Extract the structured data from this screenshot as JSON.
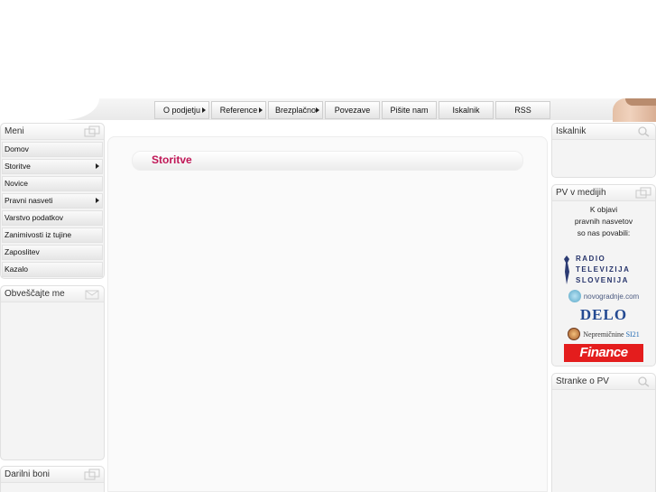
{
  "nav": {
    "items": [
      {
        "label": "O podjetju",
        "has_arrow": true
      },
      {
        "label": "Reference",
        "has_arrow": true
      },
      {
        "label": "Brezplačno",
        "has_arrow": true
      },
      {
        "label": "Povezave",
        "has_arrow": false
      },
      {
        "label": "Pišite nam",
        "has_arrow": false
      },
      {
        "label": "Iskalnik",
        "has_arrow": false
      },
      {
        "label": "RSS",
        "has_arrow": false
      }
    ]
  },
  "left": {
    "menu_title": "Meni",
    "menu_items": [
      {
        "label": "Domov",
        "has_arrow": false
      },
      {
        "label": "Storitve",
        "has_arrow": true
      },
      {
        "label": "Novice",
        "has_arrow": false
      },
      {
        "label": "Pravni nasveti",
        "has_arrow": true
      },
      {
        "label": "Varstvo podatkov",
        "has_arrow": false
      },
      {
        "label": "Zanimivosti iz tujine",
        "has_arrow": false
      },
      {
        "label": "Zaposlitev",
        "has_arrow": false
      },
      {
        "label": "Kazalo",
        "has_arrow": false
      }
    ],
    "notify_title": "Obveščajte me",
    "gift_title": "Darilni boni"
  },
  "main": {
    "title": "Storitve"
  },
  "right": {
    "search_title": "Iskalnik",
    "media_title": "PV v medijih",
    "media_text": [
      "K objavi",
      "pravnih nasvetov",
      "so nas povabili:"
    ],
    "logos": {
      "rtv": [
        "RADIO",
        "TELEVIZIJA",
        "SLOVENIJA"
      ],
      "novogradnje": "novogradnje.com",
      "delo": "DELO",
      "nepremicnine": "Nepremičnine",
      "nepremicnine_suffix": "SI21",
      "finance": "Finance"
    },
    "pages_title": "Stranke o PV"
  },
  "colors": {
    "title_accent": "#c01656",
    "panel_bg": "#f4f4f4"
  }
}
